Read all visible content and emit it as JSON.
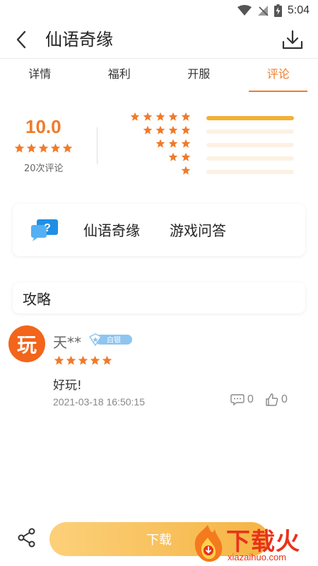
{
  "status_bar": {
    "time": "5:04",
    "icons": [
      "wifi-icon",
      "signal-off-icon",
      "battery-charging-icon"
    ]
  },
  "app_bar": {
    "title": "仙语奇缘",
    "back_icon": "chevron-left-icon",
    "download_icon": "download-icon"
  },
  "tabs": [
    {
      "label": "详情",
      "active": false
    },
    {
      "label": "福利",
      "active": false
    },
    {
      "label": "开服",
      "active": false
    },
    {
      "label": "评论",
      "active": true
    }
  ],
  "rating": {
    "score": "10.0",
    "stars": 5,
    "count_label": "20次评论",
    "distribution": [
      {
        "stars": 5,
        "fraction": 1.0
      },
      {
        "stars": 4,
        "fraction": 0.0
      },
      {
        "stars": 3,
        "fraction": 0.0
      },
      {
        "stars": 2,
        "fraction": 0.0
      },
      {
        "stars": 1,
        "fraction": 0.0
      }
    ]
  },
  "qa": {
    "game_name": "仙语奇缘",
    "label": "游戏问答",
    "icon": "question-chat-icon"
  },
  "guide": {
    "title": "攻略"
  },
  "comments": [
    {
      "avatar_text": "玩",
      "username": "天**",
      "badge": "白银",
      "stars": 5,
      "text": "好玩!",
      "time": "2021-03-18 16:50:15",
      "replies": "0",
      "likes": "0"
    }
  ],
  "bottom": {
    "share_icon": "share-icon",
    "download_label": "下载"
  },
  "watermark": {
    "text": "下载火",
    "url": "xiazaihuo.com"
  },
  "colors": {
    "accent": "#f07b2a",
    "star": "#f07b2a",
    "bar_fill": "#f3b034",
    "bar_track": "#fdf1e3",
    "download_start": "#fcd07a",
    "download_end": "#f5b443",
    "watermark": "#e8331b"
  }
}
